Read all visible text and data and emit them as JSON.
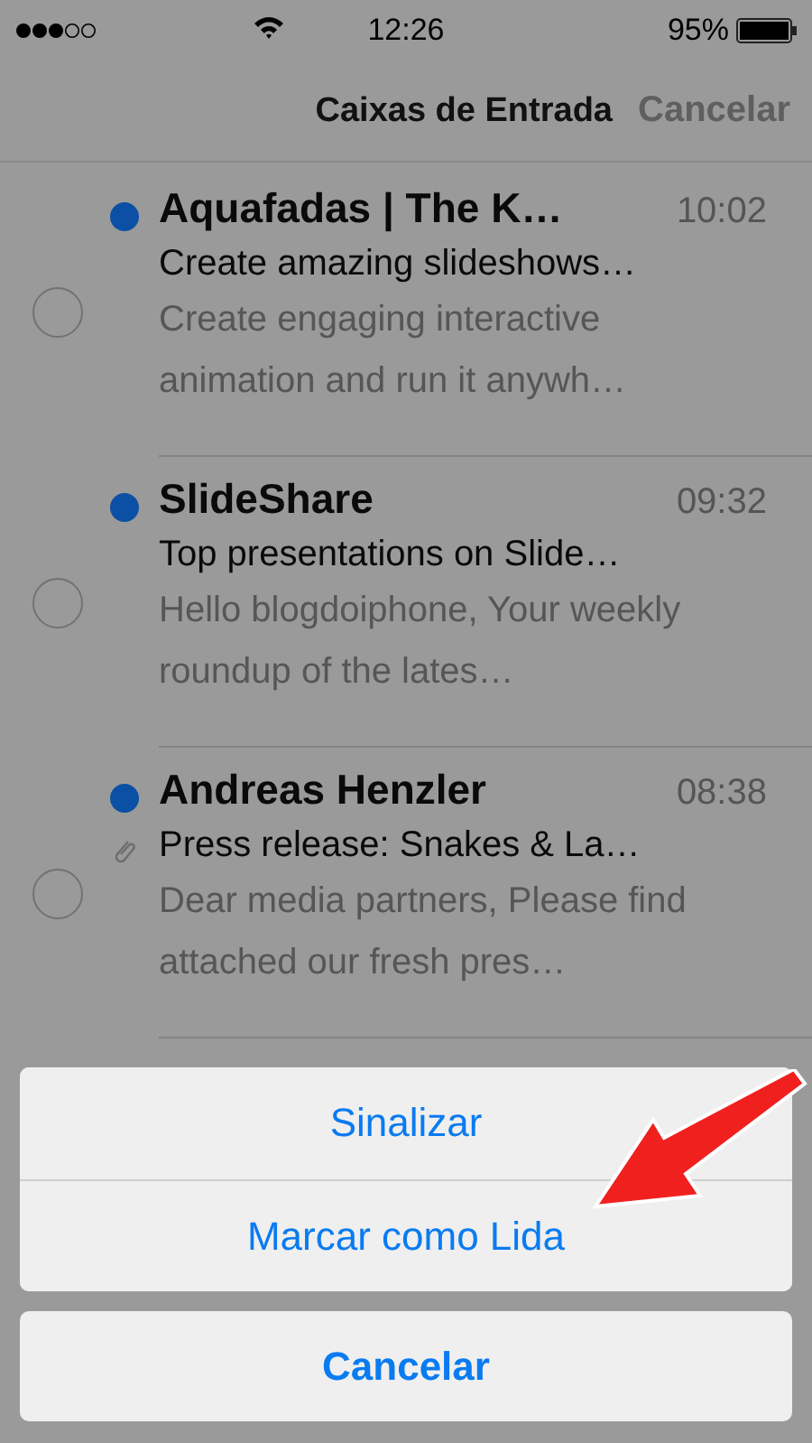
{
  "status_bar": {
    "time": "12:26",
    "battery": "95%"
  },
  "nav_bar": {
    "title": "Caixas de Entrada",
    "action": "Cancelar"
  },
  "messages": [
    {
      "sender": "Aquafadas | The K…",
      "time": "10:02",
      "subject": "Create amazing slideshows…",
      "preview": "Create engaging interactive animation and run it anywh…",
      "unread": true,
      "attachment": false,
      "selected": false
    },
    {
      "sender": "SlideShare",
      "time": "09:32",
      "subject": "Top presentations on Slide…",
      "preview": "Hello blogdoiphone, Your weekly roundup of the lates…",
      "unread": true,
      "attachment": false,
      "selected": false
    },
    {
      "sender": "Andreas Henzler",
      "time": "08:38",
      "subject": "Press release: Snakes & La…",
      "preview": "Dear media partners, Please find attached our fresh pres…",
      "unread": true,
      "attachment": true,
      "selected": false
    }
  ],
  "action_sheet": {
    "actions": [
      "Sinalizar",
      "Marcar como Lida"
    ],
    "cancel": "Cancelar"
  }
}
